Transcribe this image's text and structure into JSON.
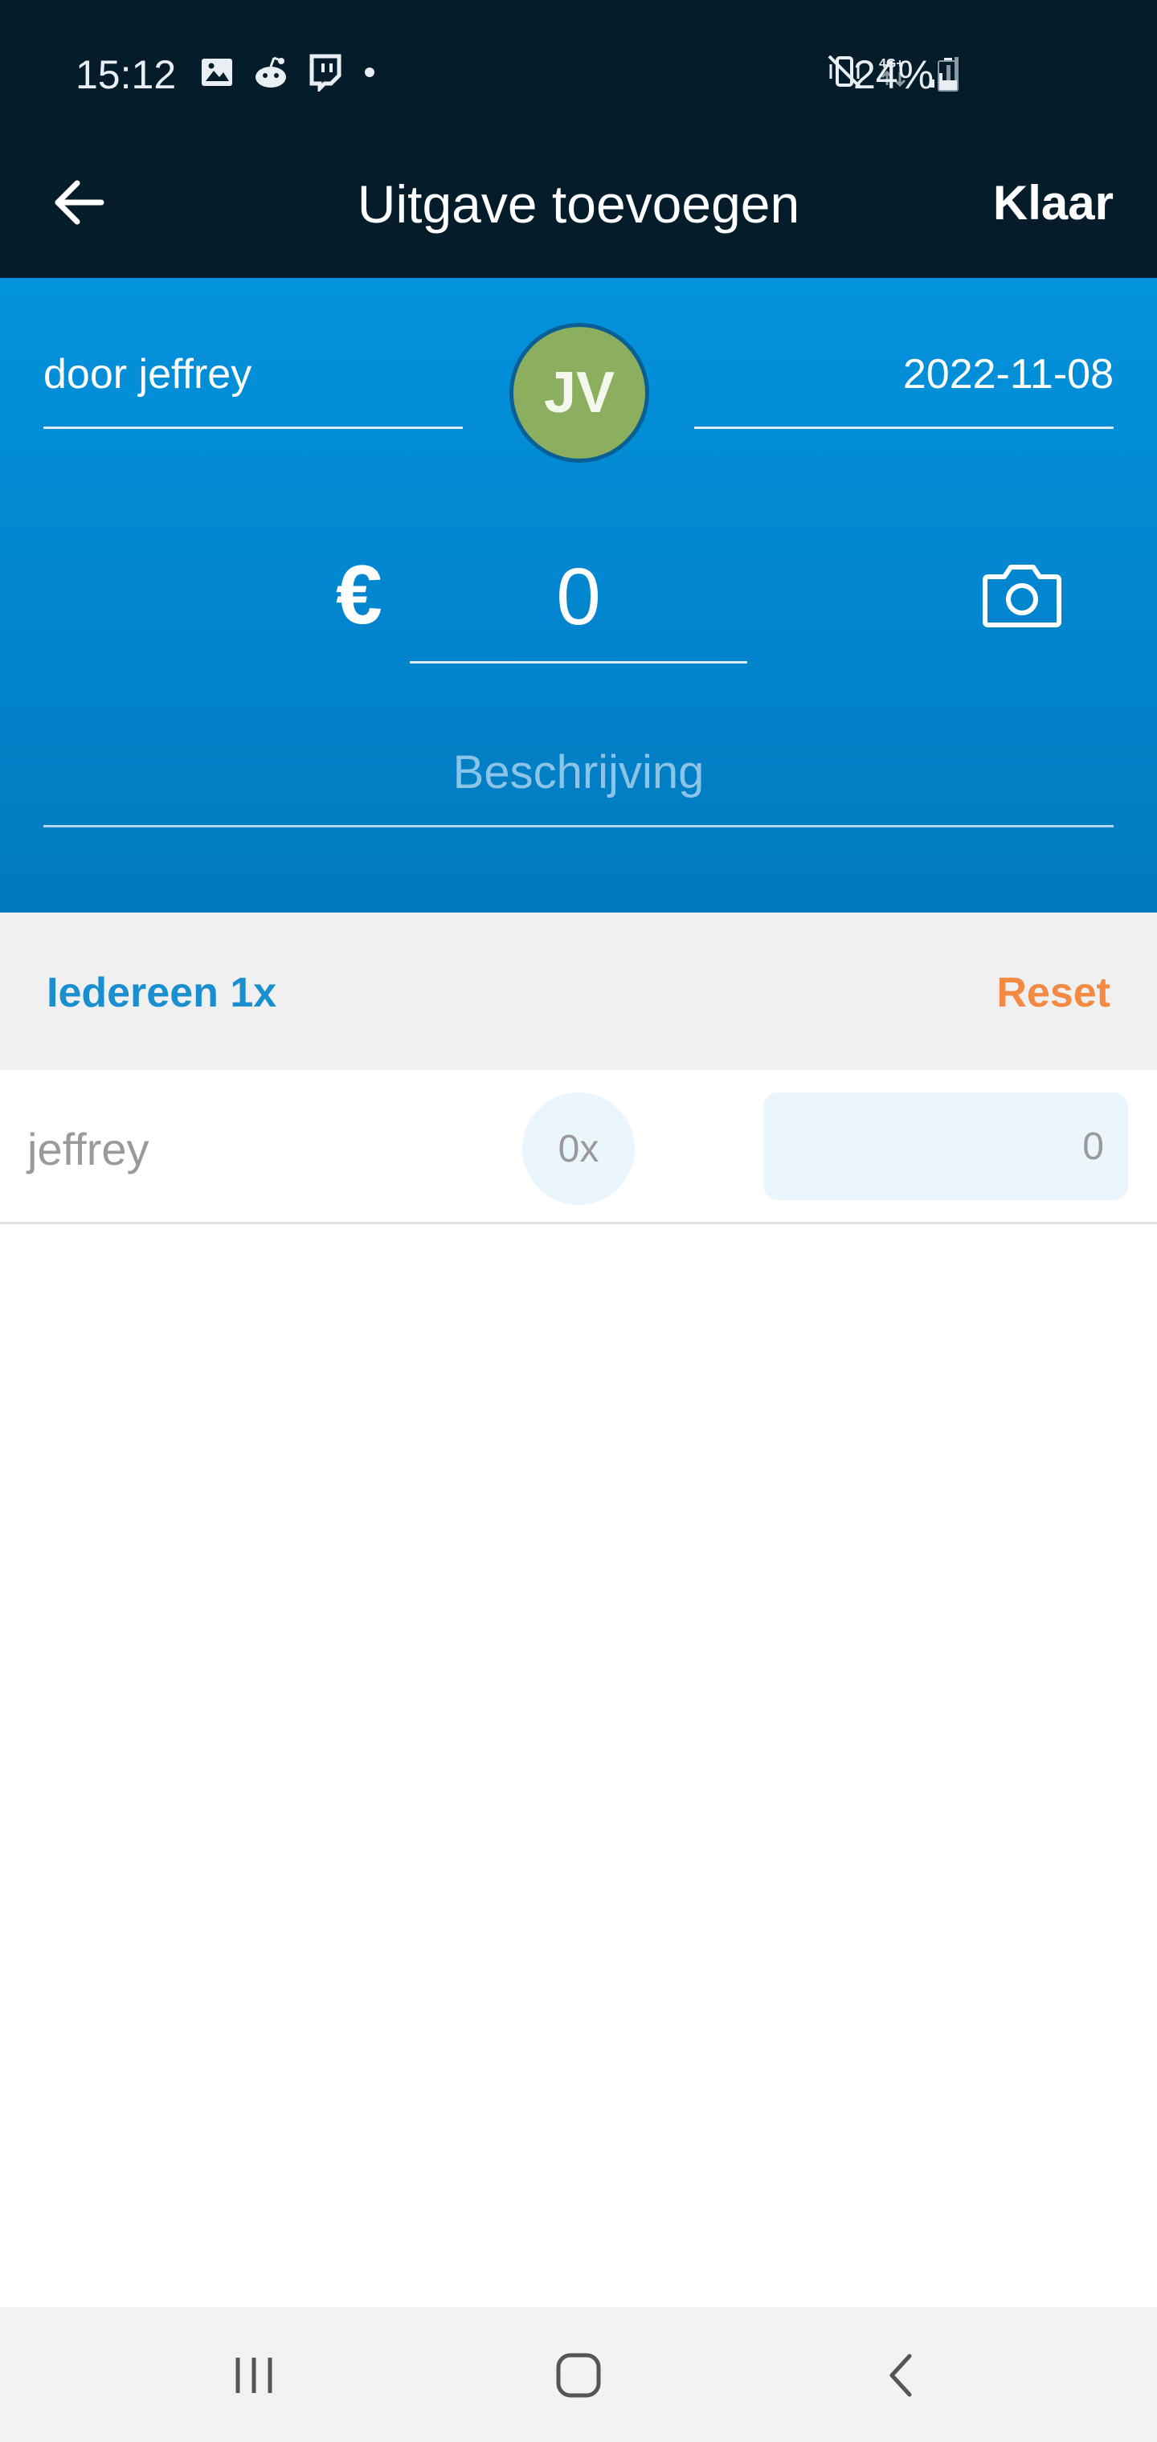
{
  "status_bar": {
    "time": "15:12",
    "battery_pct": "24%",
    "network": "4G+",
    "left_icons": [
      "gallery-icon",
      "reddit-icon",
      "twitch-icon",
      "dot-icon"
    ],
    "right_icons": [
      "vibrate-mute-icon",
      "4g-plus-icon",
      "signal-icon",
      "battery-icon"
    ]
  },
  "app_bar": {
    "title": "Uitgave toevoegen",
    "done_label": "Klaar"
  },
  "expense": {
    "payer": "door jeffrey",
    "avatar_initials": "JV",
    "date": "2022-11-08",
    "currency_symbol": "€",
    "amount": "0",
    "description_placeholder": "Beschrijving"
  },
  "actions": {
    "everyone_label": "Iedereen 1x",
    "reset_label": "Reset"
  },
  "participants": [
    {
      "name": "jeffrey",
      "weight": "0x",
      "share": "0"
    }
  ],
  "colors": {
    "status_bar_bg": "#051c2a",
    "header_blue": "#0392dc",
    "avatar_green": "#8baf5f",
    "accent_blue": "#1a8fd0",
    "reset_orange": "#f28a44"
  }
}
